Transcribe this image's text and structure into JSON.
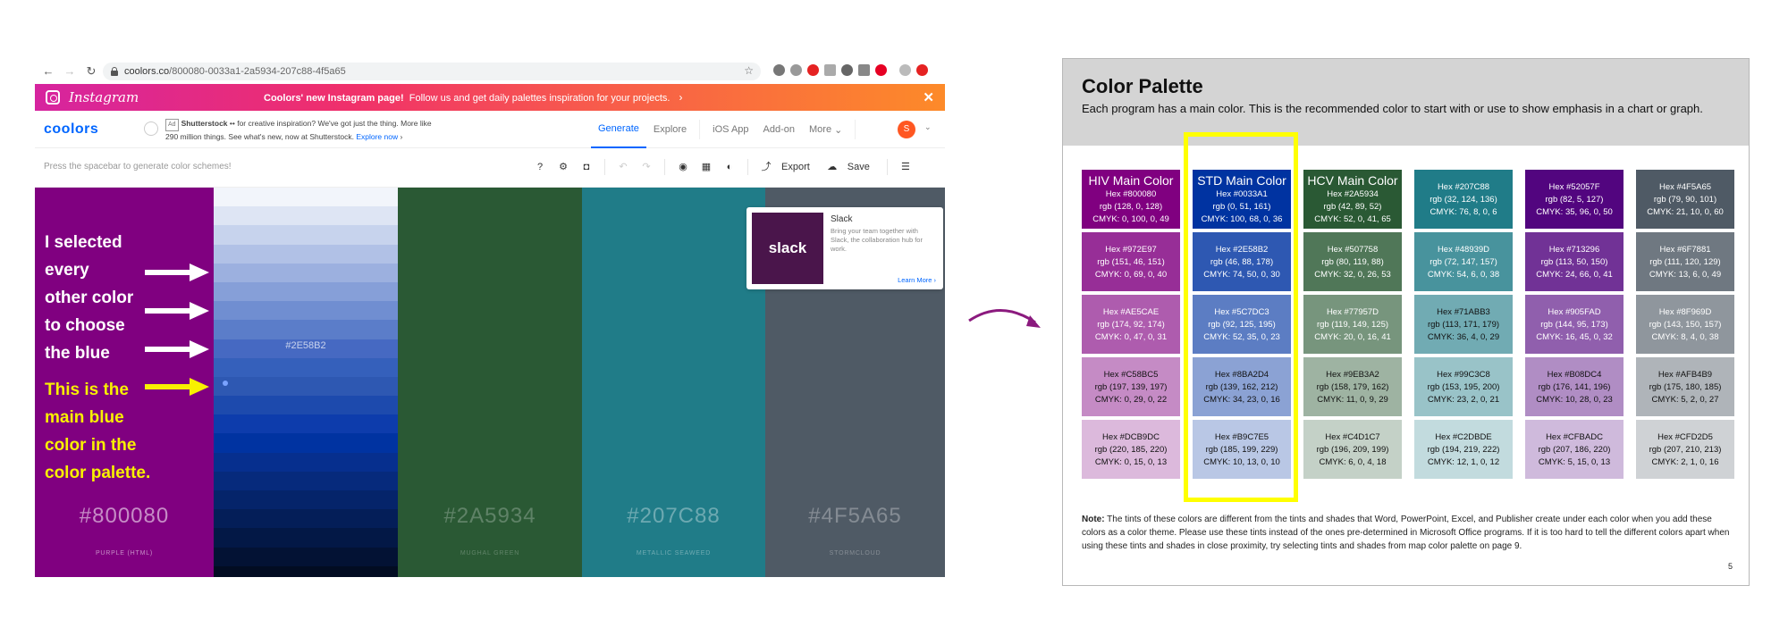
{
  "browser": {
    "url_domain": "coolors.co",
    "url_path": "/800080-0033a1-2a5934-207c88-4f5a65",
    "promo": {
      "brand": "Instagram",
      "headline": "Coolors' new Instagram page!",
      "text": "Follow us and get daily palettes inspiration for your projects.",
      "close": "✕"
    },
    "app": {
      "logo": "coolors",
      "ad_tag": "Ad",
      "ad_sponsor": "Shutterstock",
      "ad_text": "for creative inspiration? We've got just the thing. More like 290 million things. See what's new, now at Shutterstock.",
      "ad_link": "Explore now",
      "nav": [
        "Generate",
        "Explore",
        "iOS App",
        "Add-on",
        "More"
      ],
      "avatar": "S"
    },
    "toolbar": {
      "hint": "Press the spacebar to generate color schemes!",
      "export": "Export",
      "save": "Save"
    },
    "palette": [
      {
        "hex": "#800080",
        "name": "Purple (HTML)",
        "color": "#800080",
        "text_color": "rgba(255,255,255,0.55)"
      },
      {
        "hex": "#2E58B2",
        "name": "",
        "color": "#2E58B2",
        "text_color": "rgba(255,255,255,0.7)"
      },
      {
        "hex": "#2A5934",
        "name": "Mughal Green",
        "color": "#2A5934",
        "text_color": "rgba(255,255,255,0.25)"
      },
      {
        "hex": "#207C88",
        "name": "Metallic Seaweed",
        "color": "#207C88",
        "text_color": "rgba(255,255,255,0.35)"
      },
      {
        "hex": "#4F5A65",
        "name": "Stormcloud",
        "color": "#4F5A65",
        "text_color": "rgba(255,255,255,0.3)"
      }
    ],
    "blue_shades": [
      "#f2f5fb",
      "#dee5f4",
      "#c7d3ed",
      "#b1c1e6",
      "#9cb0df",
      "#869fd8",
      "#708ed1",
      "#5b7dc9",
      "#4669c2",
      "#3560bb",
      "#2e58b2",
      "#1d4aad",
      "#0d3cac",
      "#0033a1",
      "#062f8e",
      "#062a7c",
      "#05246a",
      "#041e58",
      "#031846",
      "#031234",
      "#020c22"
    ],
    "slack_ad": {
      "logo": "slack",
      "title": "Slack",
      "description": "Bring your team together with Slack, the collaboration hub for work.",
      "cta": "Learn More ›"
    }
  },
  "annotation": {
    "lines": [
      "I selected",
      "every",
      "other color",
      "to choose",
      "the blue"
    ],
    "highlight_lines": [
      "This is the",
      "main  blue",
      "color in the",
      "color palette."
    ],
    "arrow_color_white": "#ffffff",
    "arrow_color_yellow": "#f8f000",
    "curve_color": "#8b1a7e"
  },
  "document": {
    "title": "Color Palette",
    "subtitle": "Each program has a main color. This is the recommended color to start with or use to show emphasis in a chart or graph.",
    "columns": [
      {
        "swatches": [
          {
            "title": "HIV Main Color",
            "hex": "Hex #800080",
            "rgb": "rgb (128, 0, 128)",
            "cmyk": "CMYK: 0, 100, 0, 49",
            "bg": "#800080",
            "fg": "#ffffff"
          },
          {
            "title": "",
            "hex": "Hex #972E97",
            "rgb": "rgb (151, 46, 151)",
            "cmyk": "CMYK: 0, 69, 0, 40",
            "bg": "#972E97",
            "fg": "#ffffff"
          },
          {
            "title": "",
            "hex": "Hex #AE5CAE",
            "rgb": "rgb (174, 92, 174)",
            "cmyk": "CMYK: 0, 47, 0, 31",
            "bg": "#AE5CAE",
            "fg": "#ffffff"
          },
          {
            "title": "",
            "hex": "Hex #C58BC5",
            "rgb": "rgb (197, 139, 197)",
            "cmyk": "CMYK: 0, 29, 0, 22",
            "bg": "#C58BC5",
            "fg": "#111111"
          },
          {
            "title": "",
            "hex": "Hex #DCB9DC",
            "rgb": "rgb (220, 185, 220)",
            "cmyk": "CMYK: 0, 15, 0, 13",
            "bg": "#DCB9DC",
            "fg": "#111111"
          }
        ]
      },
      {
        "swatches": [
          {
            "title": "STD Main Color",
            "hex": "Hex #0033A1",
            "rgb": "rgb (0, 51, 161)",
            "cmyk": "CMYK: 100, 68, 0, 36",
            "bg": "#0033A1",
            "fg": "#ffffff"
          },
          {
            "title": "",
            "hex": "Hex #2E58B2",
            "rgb": "rgb (46, 88, 178)",
            "cmyk": "CMYK: 74, 50, 0, 30",
            "bg": "#2E58B2",
            "fg": "#ffffff"
          },
          {
            "title": "",
            "hex": "Hex #5C7DC3",
            "rgb": "rgb (92, 125, 195)",
            "cmyk": "CMYK: 52, 35, 0, 23",
            "bg": "#5C7DC3",
            "fg": "#ffffff"
          },
          {
            "title": "",
            "hex": "Hex #8BA2D4",
            "rgb": "rgb (139, 162, 212)",
            "cmyk": "CMYK: 34, 23, 0, 16",
            "bg": "#8BA2D4",
            "fg": "#111111"
          },
          {
            "title": "",
            "hex": "Hex #B9C7E5",
            "rgb": "rgb (185, 199, 229)",
            "cmyk": "CMYK: 10, 13, 0, 10",
            "bg": "#B9C7E5",
            "fg": "#111111"
          }
        ]
      },
      {
        "swatches": [
          {
            "title": "HCV Main Color",
            "hex": "Hex #2A5934",
            "rgb": "rgb (42, 89, 52)",
            "cmyk": "CMYK: 52, 0, 41, 65",
            "bg": "#2A5934",
            "fg": "#ffffff"
          },
          {
            "title": "",
            "hex": "Hex #507758",
            "rgb": "rgb (80, 119, 88)",
            "cmyk": "CMYK: 32, 0, 26, 53",
            "bg": "#507758",
            "fg": "#ffffff"
          },
          {
            "title": "",
            "hex": "Hex #77957D",
            "rgb": "rgb (119, 149, 125)",
            "cmyk": "CMYK: 20, 0, 16, 41",
            "bg": "#77957D",
            "fg": "#ffffff"
          },
          {
            "title": "",
            "hex": "Hex #9EB3A2",
            "rgb": "rgb (158, 179, 162)",
            "cmyk": "CMYK: 11, 0, 9, 29",
            "bg": "#9EB3A2",
            "fg": "#111111"
          },
          {
            "title": "",
            "hex": "Hex #C4D1C7",
            "rgb": "rgb (196, 209, 199)",
            "cmyk": "CMYK: 6, 0, 4, 18",
            "bg": "#C4D1C7",
            "fg": "#111111"
          }
        ]
      },
      {
        "swatches": [
          {
            "title": "",
            "hex": "Hex #207C88",
            "rgb": "rgb (32, 124, 136)",
            "cmyk": "CMYK: 76, 8, 0, 6",
            "bg": "#207C88",
            "fg": "#ffffff"
          },
          {
            "title": "",
            "hex": "Hex #48939D",
            "rgb": "rgb (72, 147, 157)",
            "cmyk": "CMYK: 54, 6, 0, 38",
            "bg": "#48939D",
            "fg": "#ffffff"
          },
          {
            "title": "",
            "hex": "Hex #71ABB3",
            "rgb": "rgb (113, 171, 179)",
            "cmyk": "CMYK: 36, 4, 0, 29",
            "bg": "#71ABB3",
            "fg": "#111111"
          },
          {
            "title": "",
            "hex": "Hex #99C3C8",
            "rgb": "rgb (153, 195, 200)",
            "cmyk": "CMYK: 23, 2, 0, 21",
            "bg": "#99C3C8",
            "fg": "#111111"
          },
          {
            "title": "",
            "hex": "Hex #C2DBDE",
            "rgb": "rgb (194, 219, 222)",
            "cmyk": "CMYK: 12, 1, 0, 12",
            "bg": "#C2DBDE",
            "fg": "#111111"
          }
        ]
      },
      {
        "swatches": [
          {
            "title": "",
            "hex": "Hex #52057F",
            "rgb": "rgb (82, 5, 127)",
            "cmyk": "CMYK: 35, 96, 0, 50",
            "bg": "#52057F",
            "fg": "#ffffff"
          },
          {
            "title": "",
            "hex": "Hex #713296",
            "rgb": "rgb (113, 50, 150)",
            "cmyk": "CMYK: 24, 66, 0, 41",
            "bg": "#713296",
            "fg": "#ffffff"
          },
          {
            "title": "",
            "hex": "Hex #905FAD",
            "rgb": "rgb (144, 95, 173)",
            "cmyk": "CMYK: 16, 45, 0, 32",
            "bg": "#905FAD",
            "fg": "#ffffff"
          },
          {
            "title": "",
            "hex": "Hex #B08DC4",
            "rgb": "rgb (176, 141, 196)",
            "cmyk": "CMYK: 10, 28, 0, 23",
            "bg": "#B08DC4",
            "fg": "#111111"
          },
          {
            "title": "",
            "hex": "Hex #CFBADC",
            "rgb": "rgb (207, 186, 220)",
            "cmyk": "CMYK: 5, 15, 0, 13",
            "bg": "#CFBADC",
            "fg": "#111111"
          }
        ]
      },
      {
        "swatches": [
          {
            "title": "",
            "hex": "Hex #4F5A65",
            "rgb": "rgb (79, 90, 101)",
            "cmyk": "CMYK: 21, 10, 0, 60",
            "bg": "#4F5A65",
            "fg": "#ffffff"
          },
          {
            "title": "",
            "hex": "Hex #6F7881",
            "rgb": "rgb (111, 120, 129)",
            "cmyk": "CMYK: 13, 6, 0, 49",
            "bg": "#6F7881",
            "fg": "#ffffff"
          },
          {
            "title": "",
            "hex": "Hex #8F969D",
            "rgb": "rgb (143, 150, 157)",
            "cmyk": "CMYK: 8, 4, 0, 38",
            "bg": "#8F969D",
            "fg": "#ffffff"
          },
          {
            "title": "",
            "hex": "Hex #AFB4B9",
            "rgb": "rgb (175, 180, 185)",
            "cmyk": "CMYK: 5, 2, 0, 27",
            "bg": "#AFB4B9",
            "fg": "#111111"
          },
          {
            "title": "",
            "hex": "Hex #CFD2D5",
            "rgb": "rgb (207, 210, 213)",
            "cmyk": "CMYK: 2, 1, 0, 16",
            "bg": "#CFD2D5",
            "fg": "#111111"
          }
        ]
      }
    ],
    "note_label": "Note:",
    "note": "The tints of these colors are different from the tints and shades that Word, PowerPoint, Excel, and Publisher create under each color when you add these colors as a color theme. Please use these tints instead of the ones pre-determined in Microsoft Office programs. If it is too hard to tell the different colors apart when using these tints and shades in close proximity, try selecting tints and shades from map color palette on page 9.",
    "page_number": "5",
    "highlight_color": "#ffff00"
  }
}
